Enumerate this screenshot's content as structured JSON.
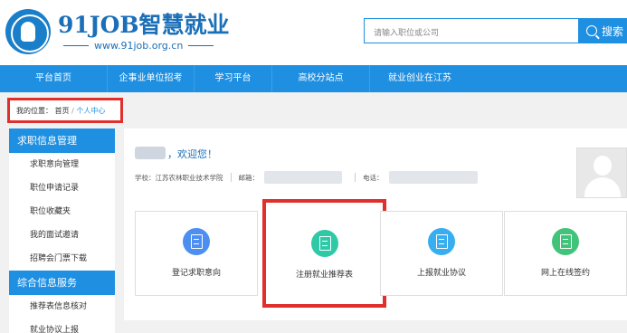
{
  "header": {
    "logo_title": "91JOB智慧就业",
    "logo_url": "www.91job.org.cn",
    "search_placeholder": "请输入职位或公司",
    "search_button": "搜索"
  },
  "nav": {
    "items": [
      "平台首页",
      "企事业单位招考",
      "学习平台",
      "高校分站点",
      "就业创业在江苏"
    ]
  },
  "breadcrumb": {
    "prefix": "我的位置：",
    "home": "首页",
    "separator": "/",
    "current": "个人中心"
  },
  "sidebar": {
    "section1": "求职信息管理",
    "items1": [
      "求职意向管理",
      "职位申请记录",
      "职位收藏夹",
      "我的面试邀请",
      "招聘会门票下载"
    ],
    "section2": "综合信息服务",
    "items2": [
      "推荐表信息核对",
      "就业协议上报"
    ]
  },
  "main": {
    "welcome": "，欢迎您！",
    "school_label": "学校：江苏农林职业技术学院",
    "email_label": "邮箱：",
    "phone_label": "电话："
  },
  "cards": [
    {
      "label": "登记求职意向",
      "color": "#4c8ff0",
      "icon": "form-icon"
    },
    {
      "label": "注册就业推荐表",
      "color": "#2ec9a6",
      "icon": "document-icon"
    },
    {
      "label": "上报就业协议",
      "color": "#38aef0",
      "icon": "agreement-icon"
    },
    {
      "label": "网上在线签约",
      "color": "#41c47a",
      "icon": "sign-icon"
    }
  ]
}
